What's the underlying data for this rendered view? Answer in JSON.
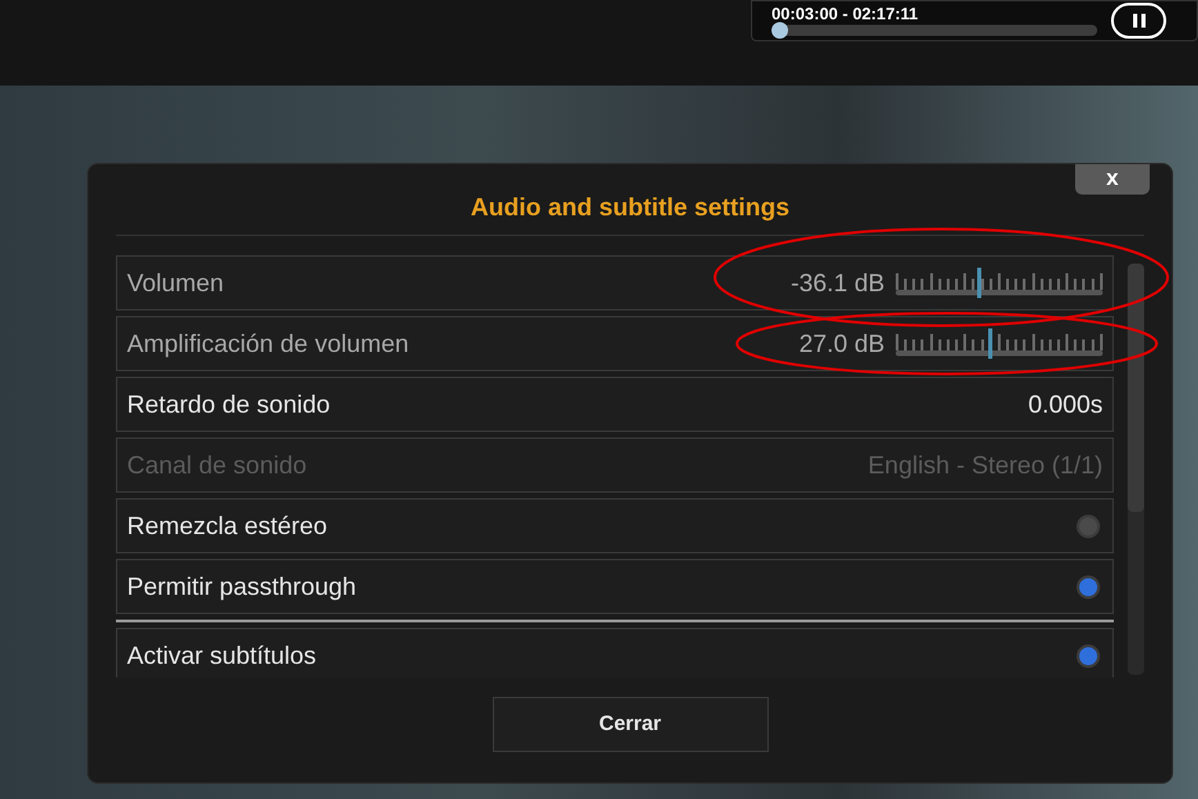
{
  "player": {
    "time": "00:03:00 - 02:17:11",
    "level": 0.0
  },
  "dialog": {
    "title": "Audio and subtitle settings",
    "close": "x",
    "groups": [
      [
        {
          "kind": "slider",
          "label": "Volumen",
          "value": "-36.1 dB",
          "level": 0.4,
          "disabled": false
        },
        {
          "kind": "slider",
          "label": "Amplificación de volumen",
          "value": "27.0 dB",
          "level": 0.45,
          "disabled": false
        },
        {
          "kind": "value",
          "label": "Retardo de sonido",
          "value": "0.000s",
          "disabled": false
        },
        {
          "kind": "value",
          "label": "Canal de sonido",
          "value": "English - Stereo (1/1)",
          "disabled": true
        },
        {
          "kind": "toggle",
          "label": "Remezcla estéreo",
          "on": false,
          "disabled": false
        },
        {
          "kind": "toggle",
          "label": "Permitir passthrough",
          "on": true,
          "disabled": false
        }
      ],
      [
        {
          "kind": "toggle",
          "label": "Activar subtítulos",
          "on": true,
          "disabled": false
        }
      ]
    ],
    "button": "Cerrar"
  }
}
